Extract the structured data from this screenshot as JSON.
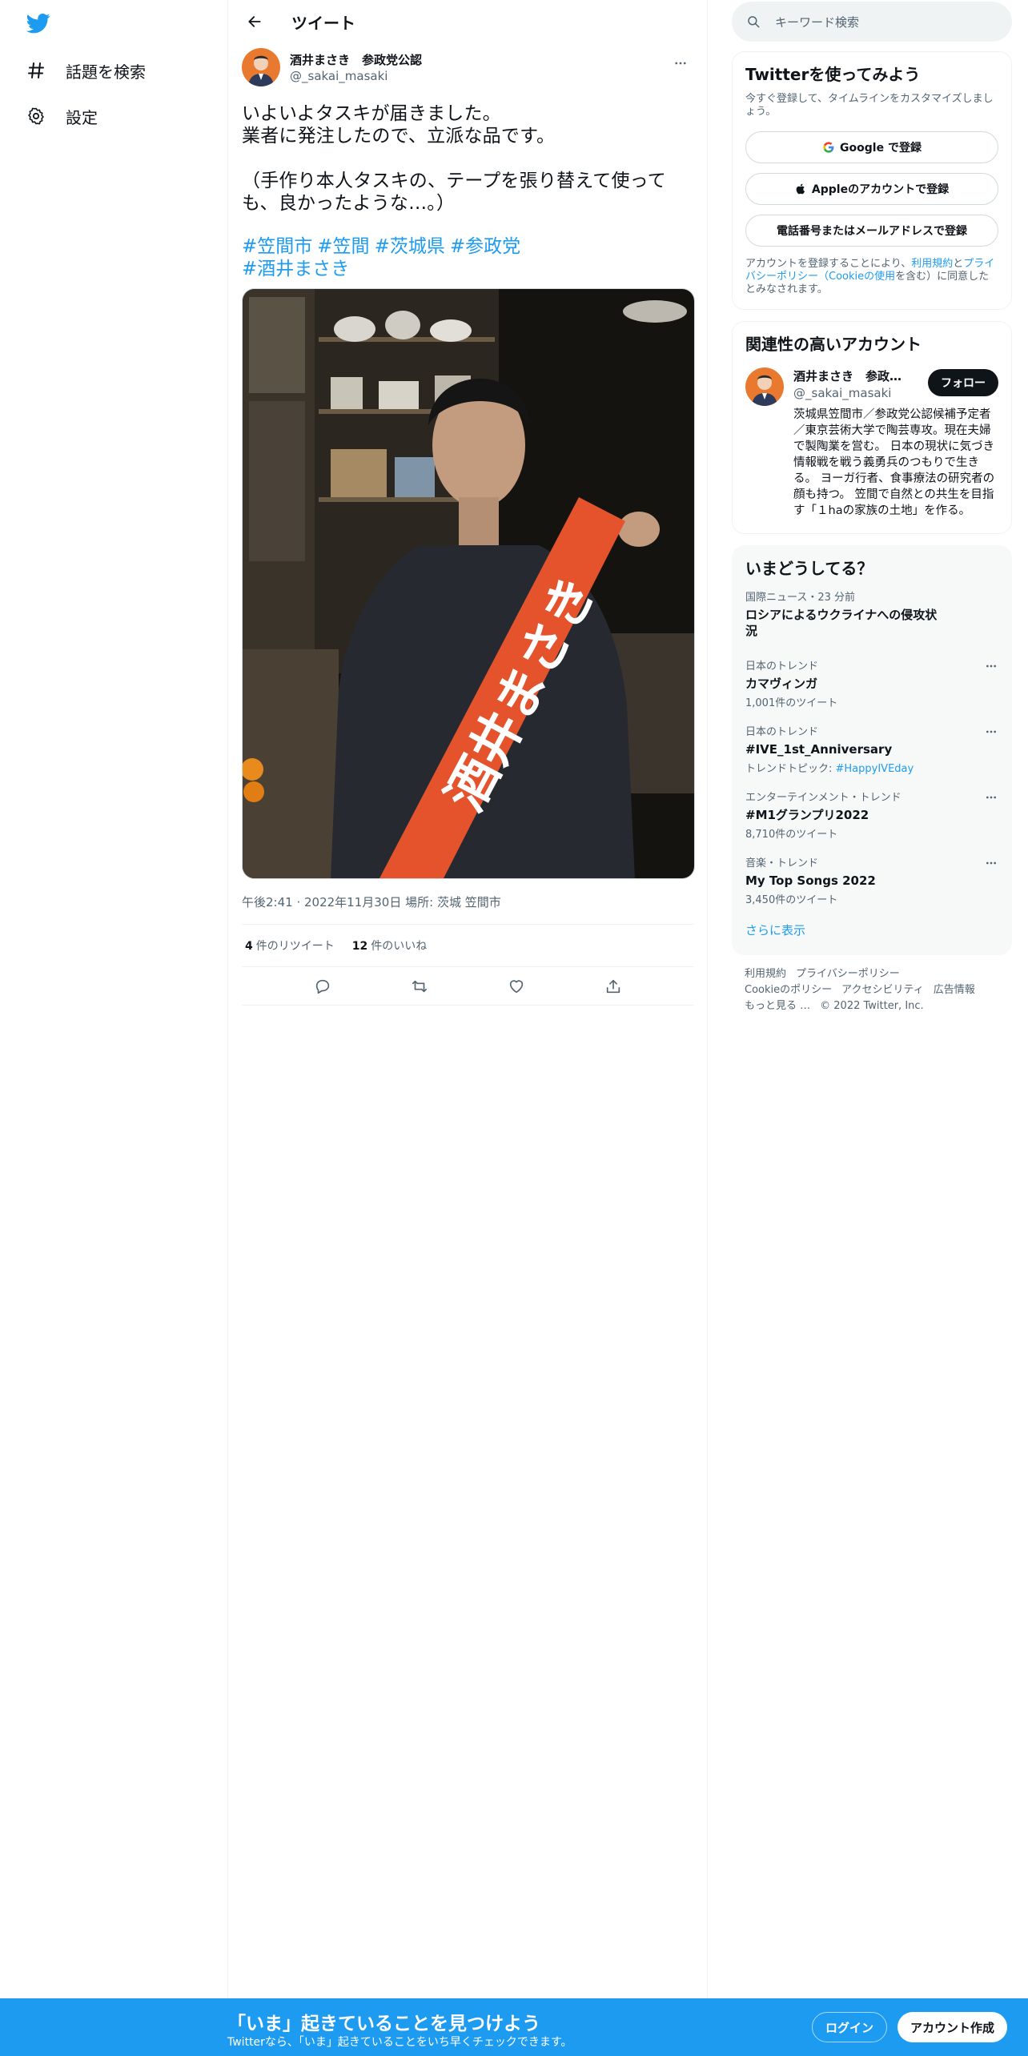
{
  "colors": {
    "accent": "#1d9bf0",
    "text": "#0f1419",
    "muted": "#536471",
    "sash": "#e5532d"
  },
  "nav": {
    "items": [
      {
        "icon": "hashtag-icon",
        "label": "話題を検索"
      },
      {
        "icon": "gear-icon",
        "label": "設定"
      }
    ]
  },
  "header": {
    "title": "ツイート"
  },
  "tweet": {
    "author_name": "酒井まさき　参政党公認",
    "author_handle": "@_sakai_masaki",
    "text": "いよいよタスキが届きました。\n業者に発注したので、立派な品です。\n\n（手作り本人タスキの、テープを張り替えて使っても、良かったような…。）",
    "hashtags": [
      "#笠間市",
      "#笠間",
      "#茨城県",
      "#参政党",
      "#酒井まさき"
    ],
    "sash_text": "酒井まさき",
    "time": "午後2:41",
    "date": "2022年11月30日",
    "place_label": "場所:",
    "place": "茨城 笠間市",
    "retweets": "4",
    "retweets_label": "件のリツイート",
    "likes": "12",
    "likes_label": "件のいいね"
  },
  "search": {
    "placeholder": "キーワード検索"
  },
  "signup": {
    "title": "Twitterを使ってみよう",
    "subtitle": "今すぐ登録して、タイムラインをカスタマイズしましょう。",
    "google": "Google で登録",
    "apple": "Appleのアカウントで登録",
    "phone": "電話番号またはメールアドレスで登録",
    "legal_1": "アカウントを登録することにより、",
    "legal_terms": "利用規約",
    "legal_2": "と",
    "legal_privacy": "プライバシーポリシー",
    "legal_cookie": "（Cookieの使用",
    "legal_3": "を含む）に同意したとみなされます。"
  },
  "related": {
    "title": "関連性の高いアカウント",
    "name": "酒井まさき　参政党公認",
    "handle": "@_sakai_masaki",
    "follow": "フォロー",
    "bio": "茨城県笠間市／参政党公認候補予定者／東京芸術大学で陶芸専攻。現在夫婦で製陶業を営む。 日本の現状に気づき情報戦を戦う義勇兵のつもりで生きる。 ヨーガ行者、食事療法の研究者の顔も持つ。 笠間で自然との共生を目指す「１haの家族の土地」を作る。"
  },
  "trends": {
    "title": "いまどうしてる？",
    "items": [
      {
        "context": "国際ニュース・23 分前",
        "title": "ロシアによるウクライナへの侵攻状況",
        "count": ""
      },
      {
        "context": "日本のトレンド",
        "title": "カマヴィンガ",
        "count": "1,001件のツイート"
      },
      {
        "context": "日本のトレンド",
        "title": "#IVE_1st_Anniversary",
        "count_prefix": "トレンドトピック: ",
        "count_link": "#HappyIVEday"
      },
      {
        "context": "エンターテインメント・トレンド",
        "title": "#M1グランプリ2022",
        "count": "8,710件のツイート"
      },
      {
        "context": "音楽・トレンド",
        "title": "My Top Songs 2022",
        "count": "3,450件のツイート"
      }
    ],
    "show_more": "さらに表示"
  },
  "footer": {
    "links": [
      "利用規約",
      "プライバシーポリシー",
      "Cookieのポリシー",
      "アクセシビリティ",
      "広告情報",
      "もっと見る …"
    ],
    "copyright": "© 2022 Twitter, Inc."
  },
  "bottom": {
    "title": "「いま」起きていることを見つけよう",
    "subtitle": "Twitterなら、「いま」起きていることをいち早くチェックできます。",
    "login": "ログイン",
    "signup": "アカウント作成"
  }
}
